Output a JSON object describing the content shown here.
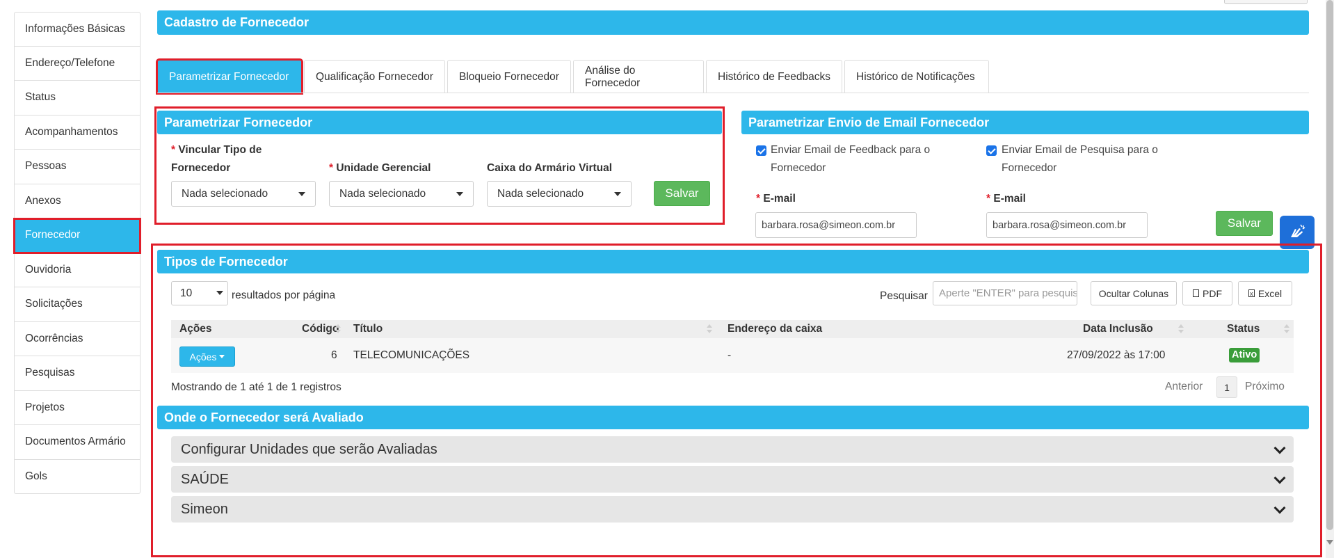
{
  "sidebar": {
    "items": [
      {
        "label": "Informações Básicas"
      },
      {
        "label": "Endereço/Telefone"
      },
      {
        "label": "Status"
      },
      {
        "label": "Acompanhamentos"
      },
      {
        "label": "Pessoas"
      },
      {
        "label": "Anexos"
      },
      {
        "label": "Fornecedor"
      },
      {
        "label": "Ouvidoria"
      },
      {
        "label": "Solicitações"
      },
      {
        "label": "Ocorrências"
      },
      {
        "label": "Pesquisas"
      },
      {
        "label": "Projetos"
      },
      {
        "label": "Documentos Armário"
      },
      {
        "label": "Gols"
      }
    ],
    "active": "Fornecedor"
  },
  "header": {
    "title": "Cadastro de Fornecedor"
  },
  "tabs": [
    {
      "label": "Parametrizar Fornecedor"
    },
    {
      "label": "Qualificação Fornecedor"
    },
    {
      "label": "Bloqueio Fornecedor"
    },
    {
      "label": "Análise do Fornecedor"
    },
    {
      "label": "Histórico de Feedbacks"
    },
    {
      "label": "Histórico de Notificações"
    }
  ],
  "param": {
    "title": "Parametrizar Fornecedor",
    "field1_label_line1": "Vincular Tipo de",
    "field1_label_line2": "Fornecedor",
    "field1_value": "Nada selecionado",
    "field2_label": "Unidade Gerencial",
    "field2_value": "Nada selecionado",
    "field3_label": "Caixa do Armário Virtual",
    "field3_value": "Nada selecionado",
    "save_label": "Salvar",
    "required_mark": "*"
  },
  "email": {
    "title": "Parametrizar Envio de Email Fornecedor",
    "check1_line1": "Enviar Email de Feedback para o",
    "check1_line2": "Fornecedor",
    "check2_line1": "Enviar Email de Pesquisa para o",
    "check2_line2": "Fornecedor",
    "label1": "E-mail",
    "value1": "barbara.rosa@simeon.com.br",
    "label2": "E-mail",
    "value2": "barbara.rosa@simeon.com.br",
    "save_label": "Salvar"
  },
  "tipos": {
    "title": "Tipos de Fornecedor",
    "page_size": "10",
    "page_size_label": "resultados por página",
    "search_label": "Pesquisar",
    "search_placeholder": "Aperte \"ENTER\" para pesquisar",
    "btn_hide": "Ocultar Colunas",
    "btn_pdf": "PDF",
    "btn_excel": "Excel",
    "columns": [
      "Ações",
      "Código",
      "Título",
      "Endereço da caixa",
      "Data Inclusão",
      "Status"
    ],
    "rows": [
      {
        "acoes": "Ações",
        "codigo": "6",
        "titulo": "TELECOMUNICAÇÕES",
        "endereco": "-",
        "data": "27/09/2022 às 17:00",
        "status": "Ativo"
      }
    ],
    "info": "Mostrando de 1 até 1 de 1 registros",
    "prev": "Anterior",
    "page": "1",
    "next": "Próximo"
  },
  "avaliado": {
    "title": "Onde o Fornecedor será Avaliado",
    "items": [
      {
        "label": "Configurar Unidades que serão Avaliadas"
      },
      {
        "label": "SAÚDE"
      },
      {
        "label": "Simeon"
      }
    ]
  },
  "colors": {
    "accent": "#2db7ea",
    "success": "#5cb85c",
    "highlight": "#e01e2a"
  },
  "icons": {
    "accessibility": "sign-language-icon",
    "dropdown": "caret-down-icon",
    "accordion": "chevron-down-icon"
  }
}
